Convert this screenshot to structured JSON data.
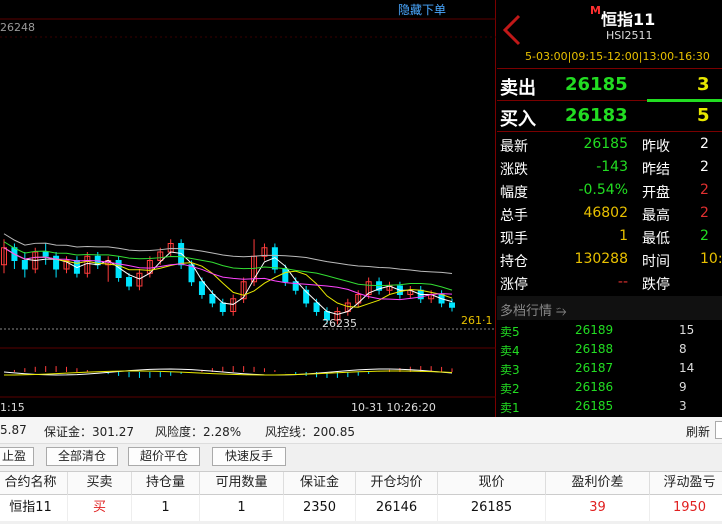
{
  "chart": {
    "hide_orders": "隐藏下单",
    "price_top": "26248",
    "low_label": "26235",
    "right_edge_price": "261·1",
    "time_left": "1:15",
    "time_mid": "10-31 10:26:20"
  },
  "chart_data": {
    "type": "candlestick",
    "ylim": [
      26215,
      26255
    ],
    "annotations": [
      "26248",
      "26235"
    ],
    "candles": [
      {
        "o": 26228,
        "c": 26232,
        "h": 26234,
        "l": 26226
      },
      {
        "o": 26232,
        "c": 26229,
        "h": 26233,
        "l": 26227
      },
      {
        "o": 26229,
        "c": 26227,
        "h": 26231,
        "l": 26225
      },
      {
        "o": 26227,
        "c": 26231,
        "h": 26232,
        "l": 26226
      },
      {
        "o": 26231,
        "c": 26230,
        "h": 26233,
        "l": 26228
      },
      {
        "o": 26230,
        "c": 26227,
        "h": 26231,
        "l": 26225
      },
      {
        "o": 26227,
        "c": 26229,
        "h": 26230,
        "l": 26226
      },
      {
        "o": 26229,
        "c": 26226,
        "h": 26230,
        "l": 26225
      },
      {
        "o": 26226,
        "c": 26230,
        "h": 26231,
        "l": 26225
      },
      {
        "o": 26230,
        "c": 26228,
        "h": 26231,
        "l": 26227
      },
      {
        "o": 26228,
        "c": 26229,
        "h": 26230,
        "l": 26224
      },
      {
        "o": 26229,
        "c": 26225,
        "h": 26230,
        "l": 26224
      },
      {
        "o": 26225,
        "c": 26223,
        "h": 26226,
        "l": 26222
      },
      {
        "o": 26223,
        "c": 26226,
        "h": 26227,
        "l": 26222
      },
      {
        "o": 26226,
        "c": 26229,
        "h": 26230,
        "l": 26225
      },
      {
        "o": 26229,
        "c": 26231,
        "h": 26232,
        "l": 26228
      },
      {
        "o": 26231,
        "c": 26233,
        "h": 26234,
        "l": 26230
      },
      {
        "o": 26233,
        "c": 26228,
        "h": 26234,
        "l": 26227
      },
      {
        "o": 26228,
        "c": 26224,
        "h": 26229,
        "l": 26223
      },
      {
        "o": 26224,
        "c": 26221,
        "h": 26225,
        "l": 26220
      },
      {
        "o": 26221,
        "c": 26219,
        "h": 26222,
        "l": 26218
      },
      {
        "o": 26219,
        "c": 26217,
        "h": 26220,
        "l": 26216
      },
      {
        "o": 26217,
        "c": 26220,
        "h": 26221,
        "l": 26216
      },
      {
        "o": 26220,
        "c": 26224,
        "h": 26225,
        "l": 26219
      },
      {
        "o": 26224,
        "c": 26230,
        "h": 26234,
        "l": 26223
      },
      {
        "o": 26230,
        "c": 26232,
        "h": 26233,
        "l": 26229
      },
      {
        "o": 26232,
        "c": 26227,
        "h": 26233,
        "l": 26226
      },
      {
        "o": 26227,
        "c": 26224,
        "h": 26228,
        "l": 26223
      },
      {
        "o": 26224,
        "c": 26222,
        "h": 26225,
        "l": 26221
      },
      {
        "o": 26222,
        "c": 26219,
        "h": 26223,
        "l": 26218
      },
      {
        "o": 26219,
        "c": 26217,
        "h": 26220,
        "l": 26216
      },
      {
        "o": 26217,
        "c": 26215,
        "h": 26218,
        "l": 26214
      },
      {
        "o": 26215,
        "c": 26217,
        "h": 26218,
        "l": 26214
      },
      {
        "o": 26217,
        "c": 26219,
        "h": 26220,
        "l": 26216
      },
      {
        "o": 26219,
        "c": 26221,
        "h": 26222,
        "l": 26218
      },
      {
        "o": 26221,
        "c": 26224,
        "h": 26225,
        "l": 26220
      },
      {
        "o": 26224,
        "c": 26222,
        "h": 26225,
        "l": 26221
      },
      {
        "o": 26222,
        "c": 26223,
        "h": 26224,
        "l": 26221
      },
      {
        "o": 26223,
        "c": 26221,
        "h": 26224,
        "l": 26220
      },
      {
        "o": 26221,
        "c": 26222,
        "h": 26223,
        "l": 26220
      },
      {
        "o": 26222,
        "c": 26220,
        "h": 26223,
        "l": 26219
      },
      {
        "o": 26220,
        "c": 26221,
        "h": 26222,
        "l": 26219
      },
      {
        "o": 26221,
        "c": 26219,
        "h": 26222,
        "l": 26218
      },
      {
        "o": 26219,
        "c": 26218,
        "h": 26220,
        "l": 26217
      }
    ]
  },
  "quote": {
    "badge": "M",
    "name": "恒指11",
    "code": "HSI2511",
    "session": "5-03:00|09:15-12:00|13:00-16:30",
    "ask": {
      "label": "卖出",
      "price": "26185",
      "vol": "3"
    },
    "bid": {
      "label": "买入",
      "price": "26183",
      "vol": "5"
    },
    "stats": [
      {
        "k1": "最新",
        "v1": "26185",
        "k2": "昨收",
        "v2": "2"
      },
      {
        "k1": "涨跌",
        "v1": "-143",
        "k2": "昨结",
        "v2": "2"
      },
      {
        "k1": "幅度",
        "v1": "-0.54%",
        "k2": "开盘",
        "v2": "2"
      },
      {
        "k1": "总手",
        "v1": "46802",
        "k2": "最高",
        "v2": "2"
      },
      {
        "k1": "现手",
        "v1": "1",
        "k2": "最低",
        "v2": "2"
      },
      {
        "k1": "持仓",
        "v1": "130288",
        "k2": "时间",
        "v2": "10:4"
      },
      {
        "k1": "涨停",
        "v1": "--",
        "k2": "跌停",
        "v2": ""
      }
    ],
    "depth_title": "多档行情",
    "depth": [
      {
        "label": "卖5",
        "price": "26189",
        "vol": "15"
      },
      {
        "label": "卖4",
        "price": "26188",
        "vol": "8"
      },
      {
        "label": "卖3",
        "price": "26187",
        "vol": "14"
      },
      {
        "label": "卖2",
        "price": "26186",
        "vol": "9"
      },
      {
        "label": "卖1",
        "price": "26185",
        "vol": "3"
      }
    ]
  },
  "account": {
    "balance_partial": "5.87",
    "margin": "保证金：301.27",
    "risk": "风险度：2.28%",
    "risk_line": "风控线：200.85",
    "refresh": "刷新"
  },
  "toolbar": {
    "stop_partial": "止盈",
    "close_all": "全部清仓",
    "over_price_close": "超价平仓",
    "fast_reverse": "快速反手"
  },
  "positions": {
    "headers": [
      "合约名称",
      "买卖",
      "持仓量",
      "可用数量",
      "保证金",
      "开仓均价",
      "现价",
      "盈利价差",
      "浮动盈亏"
    ],
    "rows": [
      [
        "恒指11",
        "买",
        "1",
        "1",
        "2350",
        "26146",
        "26185",
        "39",
        "1950"
      ]
    ]
  },
  "colors": {
    "up": "#ff3c3c",
    "down": "#00e5ff",
    "ask_bid_price": "#22dd22",
    "accent_red": "#7a0000"
  }
}
